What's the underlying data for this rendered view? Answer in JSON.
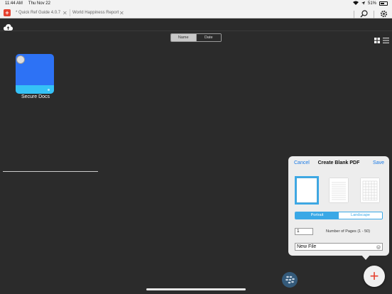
{
  "status_bar": {
    "time": "11:44 AM",
    "date": "Thu Nov 22",
    "battery": "51%"
  },
  "tabs": [
    {
      "label": "* Quick Ref Guide 4.0.7"
    },
    {
      "label": "World Happiness Report"
    }
  ],
  "sort": {
    "name_label": "Name",
    "date_label": "Date",
    "selected": "Name"
  },
  "folder": {
    "label": "Secure Docs"
  },
  "popover": {
    "cancel_label": "Cancel",
    "title": "Create Blank PDF",
    "save_label": "Save",
    "orientation": {
      "portrait_label": "Portrait",
      "landscape_label": "Landscape",
      "selected": "Portrait"
    },
    "pages_value": "1",
    "pages_label": "Number of Pages (1 - 50)",
    "filename_value": "New File"
  },
  "colors": {
    "accent": "#1a7ae6",
    "brand": "#e5412f",
    "selection": "#3aa8e6"
  }
}
